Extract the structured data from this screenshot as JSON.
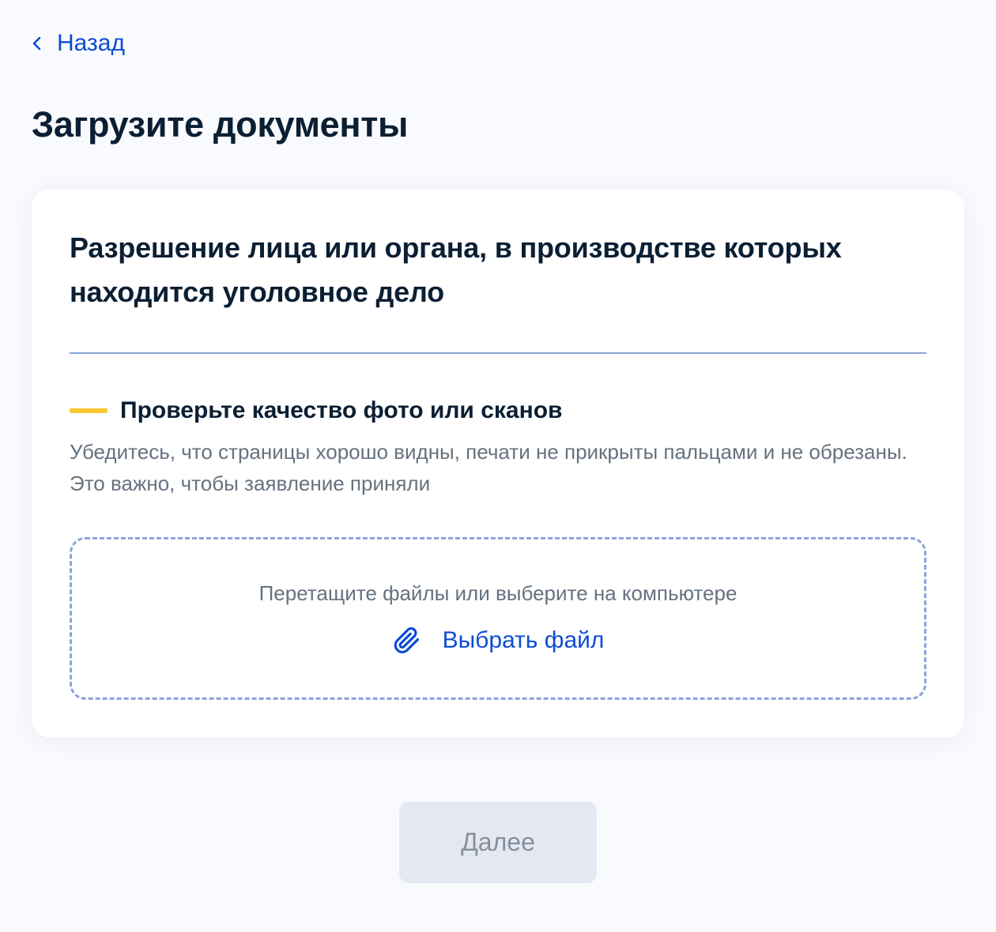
{
  "nav": {
    "back_label": "Назад"
  },
  "page": {
    "title": "Загрузите документы"
  },
  "card": {
    "title": "Разрешение лица или органа, в производстве которых находится уголовное дело",
    "warning": {
      "title": "Проверьте качество фото или сканов",
      "text": "Убедитесь, что страницы хорошо видны, печати не прикрыты пальцами и не обрезаны. Это важно, чтобы заявление приняли",
      "accent_color": "#fcc934"
    },
    "dropzone": {
      "hint": "Перетащите файлы или выберите на компьютере",
      "pick_label": "Выбрать файл",
      "pick_icon": "paperclip-icon"
    }
  },
  "footer": {
    "next_label": "Далее",
    "next_disabled": true
  },
  "colors": {
    "link": "#0d4cd3",
    "text": "#0b1f33",
    "muted": "#66727f",
    "border": "#8aa4d8",
    "background": "#f9fafd"
  }
}
